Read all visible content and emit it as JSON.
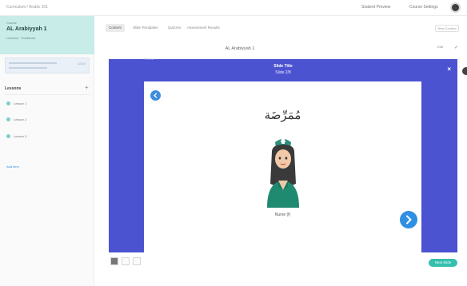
{
  "topbar": {
    "breadcrumb": "Curriculum / Arabic 101",
    "link_1": "Student Preview",
    "link_2": "Course Settings"
  },
  "sidebar": {
    "course_label": "Course",
    "course_title": "AL Arabiyyah 1",
    "course_meta": "Lessons · Published",
    "section_title": "Lessons",
    "add_symbol": "+",
    "items": [
      {
        "label": "Lesson 1"
      },
      {
        "label": "Lesson 2"
      },
      {
        "label": "Lesson 3"
      }
    ],
    "link": "Add item",
    "progress_stat": "12/20"
  },
  "main": {
    "tabs": [
      {
        "label": "Content"
      },
      {
        "label": "Slide Templates"
      },
      {
        "label": "Quizzes"
      },
      {
        "label": "Assessment Results"
      }
    ],
    "tool_button": "New Content",
    "lesson_title": "AL Arabiyyah 1",
    "right_control": "Edit"
  },
  "player": {
    "title": "Slide Title",
    "subtitle": "Slide 2/8",
    "tag": "Preview",
    "arabic_word": "مُمَرِّضَة",
    "caption": "Nurse (f)"
  },
  "bottom": {
    "button": "Next Slide"
  },
  "colors": {
    "accent_teal": "#37bfae",
    "player_bg": "#4b53d1",
    "button_blue": "#2f8fe3"
  }
}
